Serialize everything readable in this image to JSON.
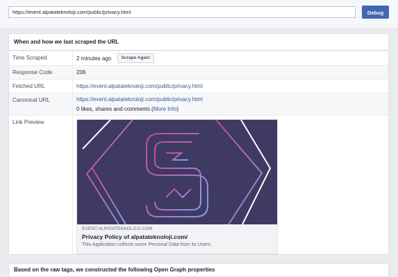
{
  "toolbar": {
    "url_value": "https://event.alpatateknoloji.com/public/privacy.html",
    "debug_label": "Debug"
  },
  "panel": {
    "header": "When and how we last scraped the URL",
    "time_scraped": {
      "label": "Time Scraped",
      "value": "2 minutes ago",
      "button": "Scrape Again"
    },
    "response_code": {
      "label": "Response Code",
      "value": "206"
    },
    "fetched_url": {
      "label": "Fetched URL",
      "value": "https://event.alpatateknoloji.com/public/privacy.html"
    },
    "canonical_url": {
      "label": "Canonical URL",
      "value": "https://event.alpatateknoloji.com/public/privacy.html",
      "stats_prefix": "0 likes, shares and comments (",
      "stats_link": "More Info",
      "stats_suffix": ")"
    },
    "link_preview": {
      "label": "Link Preview",
      "domain": "EVENT.ALPATATEKNOLOJI.COM",
      "title": "Privacy Policy of alpatateknoloji.com/",
      "description": "This Application collects some Personal Data from its Users."
    }
  },
  "bottom_panel": {
    "text": "Based on the raw tags, we constructed the following Open Graph properties"
  },
  "colors": {
    "accent": "#4267b2",
    "link": "#365899",
    "preview_bg": "#3e3a62"
  }
}
